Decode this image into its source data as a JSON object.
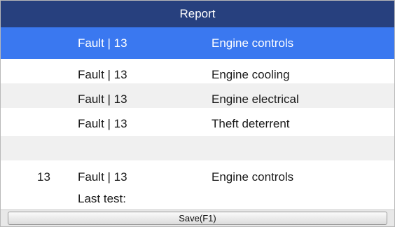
{
  "header": {
    "title": "Report"
  },
  "rows": [
    {
      "index": "",
      "fault": "Fault | 13",
      "system": "Engine controls",
      "selected": true
    },
    {
      "index": "",
      "fault": "Fault | 13",
      "system": "Engine cooling",
      "selected": false
    },
    {
      "index": "",
      "fault": "Fault | 13",
      "system": "Engine electrical",
      "selected": false
    },
    {
      "index": "",
      "fault": "Fault | 13",
      "system": "Theft deterrent",
      "selected": false
    },
    {
      "index": "",
      "fault": "",
      "system": "",
      "selected": false
    }
  ],
  "detail": {
    "code": "13",
    "fault": "Fault | 13",
    "system": "Engine controls",
    "last_test_label": "Last test:"
  },
  "footer": {
    "save_label": "Save(F1)"
  },
  "colors": {
    "title_bar": "#27407e",
    "selected_row": "#3a78f0",
    "alt_row": "#f0f0f0"
  }
}
